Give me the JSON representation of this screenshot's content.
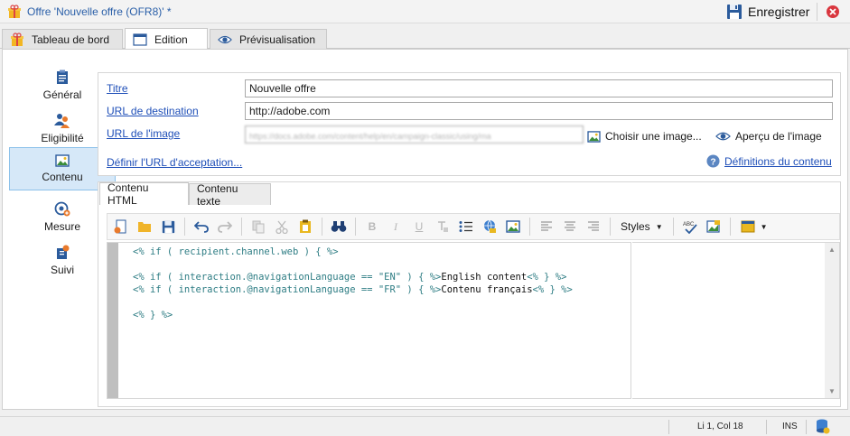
{
  "window": {
    "title": "Offre 'Nouvelle offre (OFR8)' *",
    "save_label": "Enregistrer"
  },
  "main_tabs": [
    {
      "label": "Tableau de bord",
      "icon": "gift-icon"
    },
    {
      "label": "Edition",
      "icon": "window-icon",
      "active": true
    },
    {
      "label": "Prévisualisation",
      "icon": "eye-icon"
    }
  ],
  "sidebar": {
    "items": [
      {
        "label": "Général",
        "icon": "clipboard-icon"
      },
      {
        "label": "Eligibilité",
        "icon": "people-icon"
      },
      {
        "label": "Contenu",
        "icon": "image-icon",
        "active": true
      },
      {
        "label": "Mesure",
        "icon": "target-icon"
      },
      {
        "label": "Suivi",
        "icon": "tracking-icon"
      }
    ]
  },
  "form": {
    "title_label": "Titre",
    "title_value": "Nouvelle offre",
    "dest_url_label": "URL de destination",
    "dest_url_value": "http://adobe.com",
    "image_url_label": "URL de l'image",
    "image_url_value": "https://docs.adobe.com/content/help/en/campaign-classic/using/ma",
    "choose_image_label": "Choisir une image...",
    "image_preview_label": "Aperçu de l'image",
    "accept_url_label": "Définir l'URL d'acceptation...",
    "content_defs_label": "Définitions du contenu"
  },
  "editor": {
    "tabs": [
      {
        "label": "Contenu HTML",
        "active": true
      },
      {
        "label": "Contenu texte"
      }
    ],
    "toolbar": {
      "styles_label": "Styles",
      "bold": "B",
      "italic": "I",
      "underline": "U"
    },
    "code": {
      "line1": "<% if ( recipient.channel.web ) { %>",
      "line3_a": "<% if ( interaction.@navigationLanguage == \"EN\" ) { %>",
      "line3_b": "English content",
      "line3_c": "<% } %>",
      "line4_a": "<% if ( interaction.@navigationLanguage == \"FR\" ) { %>",
      "line4_b": "Contenu français",
      "line4_c": "<% } %>",
      "line6": "<% } %>"
    }
  },
  "status": {
    "position": "Li 1, Col 18",
    "mode": "INS"
  },
  "colors": {
    "link": "#1f4fb8",
    "code": "#2e7d84",
    "nav_active_bg": "#d6e8f8",
    "title_text": "#2a5fa8"
  }
}
